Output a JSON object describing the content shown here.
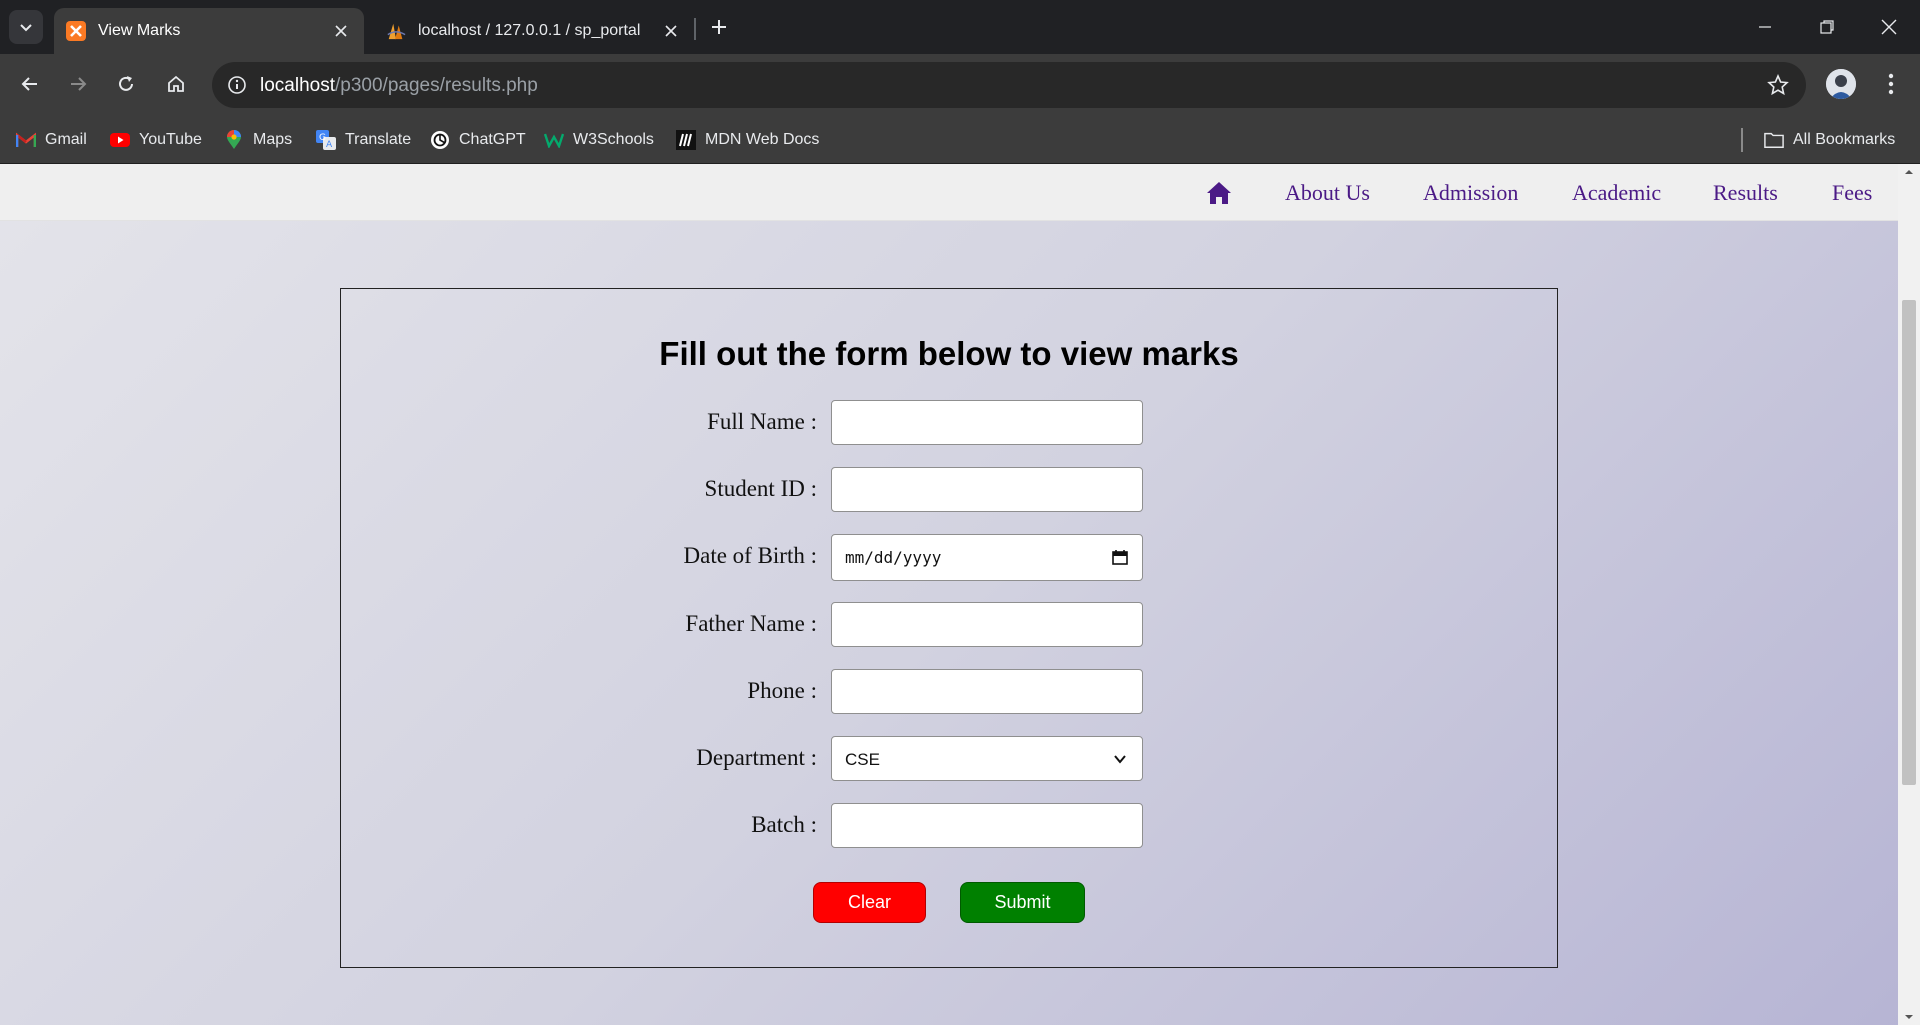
{
  "browser": {
    "tabs": [
      {
        "title": "View Marks",
        "active": true,
        "favicon": "xampp-icon"
      },
      {
        "title": "localhost / 127.0.0.1 / sp_portal",
        "active": false,
        "favicon": "phpmyadmin-icon"
      }
    ],
    "url_host": "localhost",
    "url_path": "/p300/pages/results.php",
    "bookmarks": [
      "Gmail",
      "YouTube",
      "Maps",
      "Translate",
      "ChatGPT",
      "W3Schools",
      "MDN Web Docs"
    ],
    "all_bookmarks": "All Bookmarks"
  },
  "nav": {
    "items": [
      "About Us",
      "Admission",
      "Academic",
      "Results",
      "Fees"
    ],
    "home_icon": "home-icon",
    "color": "#4b1a86"
  },
  "form": {
    "title": "Fill out the form below to view marks",
    "labels": {
      "full_name": "Full Name :",
      "student_id": "Student ID :",
      "dob": "Date of Birth :",
      "father_name": "Father Name :",
      "phone": "Phone :",
      "department": "Department :",
      "batch": "Batch :"
    },
    "dob_placeholder": "mm/dd/yyyy",
    "department_value": "CSE",
    "buttons": {
      "clear": "Clear",
      "submit": "Submit"
    },
    "colors": {
      "clear": "#ff0000",
      "submit": "#008000"
    }
  }
}
